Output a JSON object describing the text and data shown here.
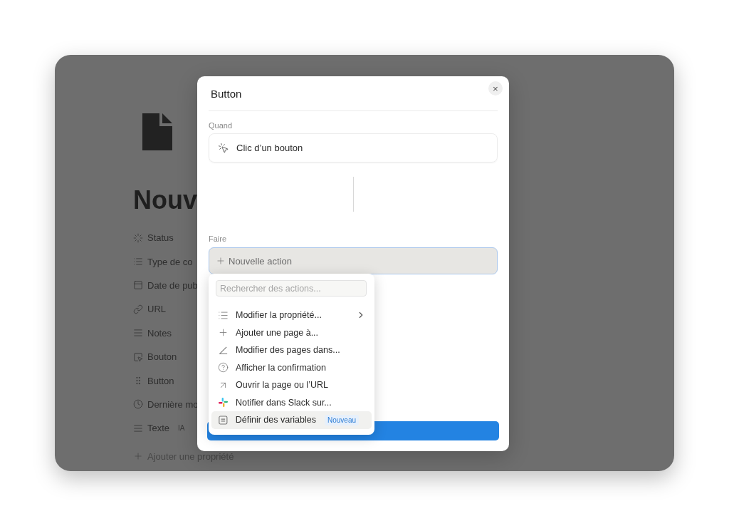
{
  "page": {
    "title": "Nouv",
    "properties": [
      {
        "kind": "status",
        "label": "Status"
      },
      {
        "kind": "list",
        "label": "Type de co"
      },
      {
        "kind": "date",
        "label": "Date de pub"
      },
      {
        "kind": "link",
        "label": "URL"
      },
      {
        "kind": "text",
        "label": "Notes"
      },
      {
        "kind": "button",
        "label": "Bouton"
      },
      {
        "kind": "grip",
        "label": "Button"
      },
      {
        "kind": "clock",
        "label": "Dernière mo"
      },
      {
        "kind": "text",
        "label": "Texte",
        "badge": "IA"
      }
    ],
    "add_property": "Ajouter une propriété"
  },
  "dialog": {
    "title": "Button",
    "close": "×",
    "when_label": "Quand",
    "trigger": "Clic d’un bouton",
    "do_label": "Faire",
    "new_action": {
      "placeholder": "Nouvelle action"
    },
    "menu": {
      "search": {
        "placeholder": "Rechercher des actions..."
      },
      "items": [
        {
          "kind": "list",
          "label": "Modifier la propriété...",
          "submenu": true,
          "selected": false
        },
        {
          "kind": "plus",
          "label": "Ajouter une page à...",
          "submenu": false,
          "selected": false
        },
        {
          "kind": "angle",
          "label": "Modifier des pages dans...",
          "submenu": false,
          "selected": false
        },
        {
          "kind": "help",
          "label": "Afficher la confirmation",
          "submenu": false,
          "selected": false
        },
        {
          "kind": "arrow",
          "label": "Ouvrir la page ou l’URL",
          "submenu": false,
          "selected": false
        },
        {
          "kind": "slack",
          "label": "Notifier dans Slack sur...",
          "submenu": false,
          "selected": false
        },
        {
          "kind": "variables",
          "label": "Définir des variables",
          "badge": "Nouveau",
          "submenu": false,
          "selected": true
        }
      ]
    }
  }
}
